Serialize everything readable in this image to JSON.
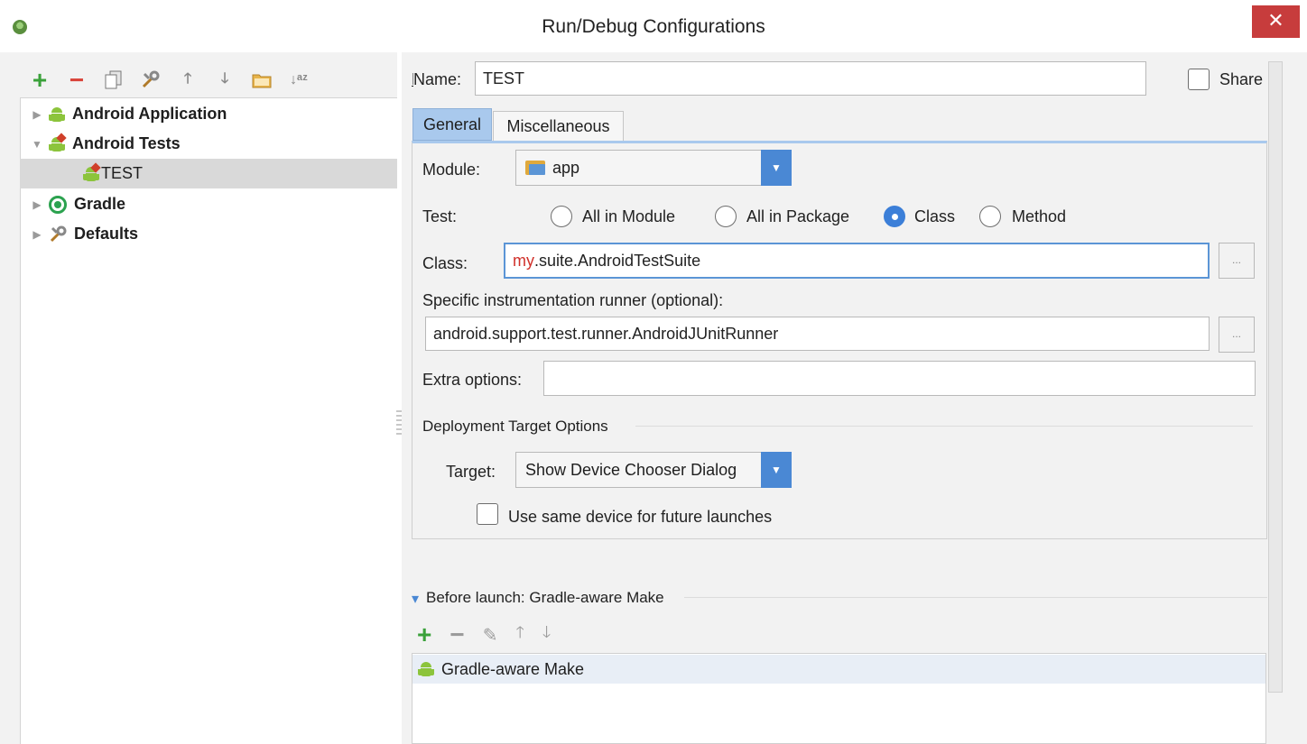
{
  "window": {
    "title": "Run/Debug Configurations",
    "close_glyph": "✕"
  },
  "left_toolbar": {
    "icons": [
      "add-icon",
      "remove-icon",
      "copy-icon",
      "edit-defaults-icon",
      "move-up-icon",
      "move-down-icon",
      "folder-icon",
      "sort-icon"
    ],
    "add": "+",
    "remove": "−",
    "up": "🡑",
    "down": "🡓",
    "sort": "↓ᵃᶻ"
  },
  "tree": {
    "items": [
      {
        "label": "Android Application",
        "expanded": false
      },
      {
        "label": "Android Tests",
        "expanded": true
      },
      {
        "label": "TEST",
        "selected": true
      },
      {
        "label": "Gradle",
        "expanded": false
      },
      {
        "label": "Defaults",
        "expanded": false
      }
    ]
  },
  "form": {
    "name_label": "Name:",
    "name_value": "TEST",
    "share_label": "Share",
    "share_checked": false,
    "tabs": [
      {
        "label": "General",
        "active": true
      },
      {
        "label": "Miscellaneous",
        "active": false
      }
    ],
    "module_label": "Module:",
    "module_value": "app",
    "test_label": "Test:",
    "test_options": [
      "All in Module",
      "All in Package",
      "Class",
      "Method"
    ],
    "test_selected": "Class",
    "class_label": "Class:",
    "class_value_highlight": "my",
    "class_value_rest": ".suite.AndroidTestSuite",
    "browse_label": "...",
    "runner_label": "Specific instrumentation runner (optional):",
    "runner_value": "android.support.test.runner.AndroidJUnitRunner",
    "extra_label": "Extra options:",
    "extra_value": "",
    "deploy_section": "Deployment Target Options",
    "target_label": "Target:",
    "target_value": "Show Device Chooser Dialog",
    "same_device_label": "Use same device for future launches",
    "same_device_checked": false
  },
  "before_launch": {
    "title": "Before launch: Gradle-aware Make",
    "toolbar": {
      "add": "+",
      "remove": "−",
      "edit": "✎",
      "up": "🡑",
      "down": "🡓"
    },
    "items": [
      "Gradle-aware Make"
    ]
  },
  "colors": {
    "accent": "#4a88d4",
    "tab_active": "#a9c9ed",
    "close": "#c73c3c",
    "add_green": "#3aa13a",
    "remove_red": "#d9443a",
    "highlight_red": "#d0302a"
  }
}
